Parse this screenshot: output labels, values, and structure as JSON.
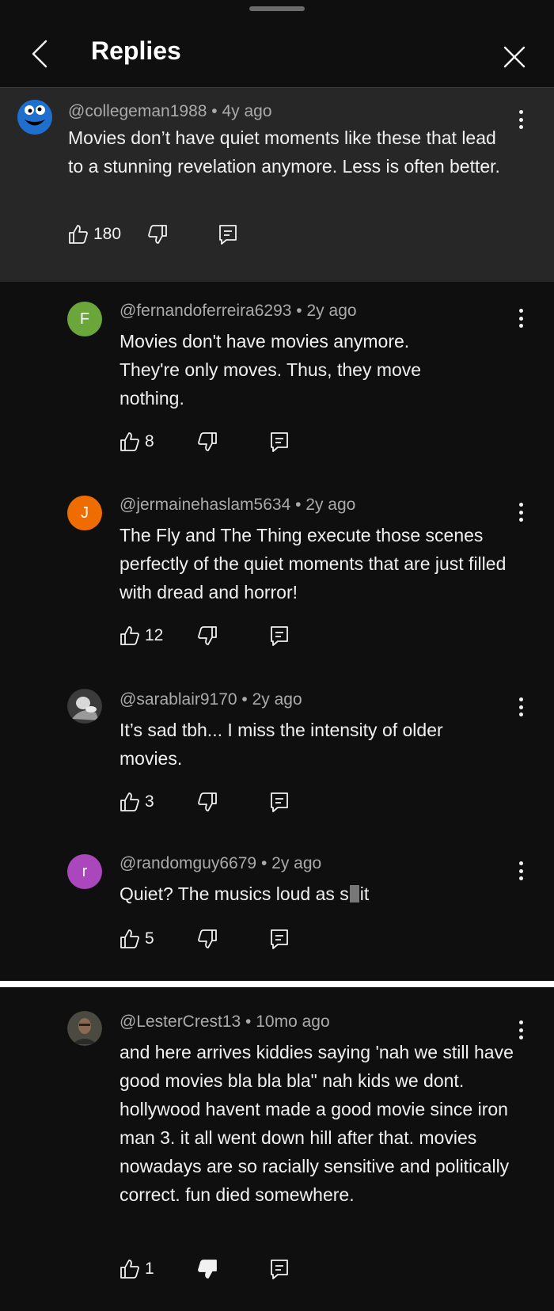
{
  "header": {
    "title": "Replies"
  },
  "parent": {
    "handle": "@collegeman1988",
    "age": "4y ago",
    "text": "Movies don’t have quiet moments like these that lead to a stunning revelation anymore.  Less is often better.",
    "likes": "180"
  },
  "replies": [
    {
      "initial": "F",
      "avatar_color": "#6aa63a",
      "handle": "@fernandoferreira6293",
      "age": "2y ago",
      "text": "Movies don't have movies anymore. They're only moves. Thus, they move nothing.",
      "likes": "8"
    },
    {
      "initial": "J",
      "avatar_color": "#ef6c00",
      "handle": "@jermainehaslam5634",
      "age": "2y ago",
      "text": "The Fly and The Thing execute those scenes perfectly of the quiet moments that are just filled with dread and horror!",
      "likes": "12"
    },
    {
      "initial": "",
      "avatar_color": "#4a4a4a",
      "handle": "@sarablair9170",
      "age": "2y ago",
      "text": "It’s sad tbh... I miss the intensity of older movies.",
      "likes": "3"
    },
    {
      "initial": "r",
      "avatar_color": "#ab47bc",
      "handle": "@randomguy6679",
      "age": "2y ago",
      "text_before": "Quiet? The musics loud as s",
      "text_after": "it",
      "likes": "5"
    }
  ],
  "second_panel": {
    "handle": "@LesterCrest13",
    "age": "10mo ago",
    "text": "and here arrives kiddies saying 'nah we still have good movies bla bla bla\" nah kids we dont. hollywood havent made a good movie since iron man 3. it all went down hill after that. movies nowadays are so racially sensitive and politically correct. fun died somewhere.",
    "likes": "1"
  },
  "sep": " • ",
  "icons": [
    "chevron-left-icon",
    "close-icon",
    "more-vert-icon",
    "thumb-up-icon",
    "thumb-down-icon",
    "thumb-down-filled-icon",
    "reply-icon",
    "cookie-monster-avatar"
  ]
}
